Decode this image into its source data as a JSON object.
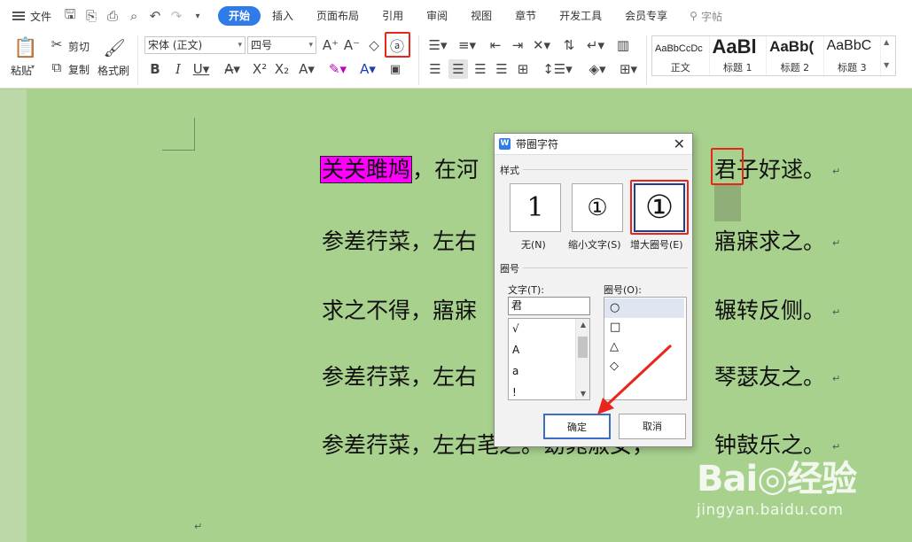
{
  "menubar": {
    "file_label": "文件",
    "tabs": [
      {
        "label": "开始",
        "active": true
      },
      {
        "label": "插入"
      },
      {
        "label": "页面布局"
      },
      {
        "label": "引用"
      },
      {
        "label": "审阅"
      },
      {
        "label": "视图"
      },
      {
        "label": "章节"
      },
      {
        "label": "开发工具"
      },
      {
        "label": "会员专享"
      }
    ],
    "search_label": "字帖"
  },
  "ribbon": {
    "paste_label": "粘贴",
    "cut_label": "剪切",
    "copy_label": "复制",
    "format_painter_label": "格式刷",
    "font_name": "宋体 (正文)",
    "font_size": "四号",
    "styles": [
      {
        "preview": "AaBbCcDc",
        "name": "正文"
      },
      {
        "preview": "AaBl",
        "name": "标题 1"
      },
      {
        "preview": "AaBb(",
        "name": "标题 2"
      },
      {
        "preview": "AaBbC",
        "name": "标题 3"
      }
    ]
  },
  "document": {
    "lines": [
      {
        "highlight": "关关雎鸠",
        "before": "，在河",
        "after": "君子好逑。"
      },
      {
        "before": "参差荇菜，左右",
        "after": "寤寐求之。"
      },
      {
        "before": "求之不得，寤寐",
        "after": "辗转反侧。"
      },
      {
        "before": "参差荇菜，左右",
        "after": "琴瑟友之。"
      },
      {
        "before": "参差荇菜，左右芼之。窈窕淑女，",
        "after": "钟鼓乐之。"
      }
    ],
    "paragraph_mark": "↵"
  },
  "dialog": {
    "title": "带圈字符",
    "close": "✕",
    "style_section": "样式",
    "style_options": [
      {
        "label": "无(N)",
        "glyph": "1"
      },
      {
        "label": "缩小文字(S)",
        "glyph": "①"
      },
      {
        "label": "增大圈号(E)",
        "glyph": "①",
        "selected": true
      }
    ],
    "enclosure_section": "圈号",
    "text_label": "文字(T):",
    "text_value": "君",
    "text_list": [
      "√",
      "A",
      "a",
      "!"
    ],
    "enclosure_label": "圈号(O):",
    "enclosure_list": [
      "○",
      "□",
      "△",
      "◇"
    ],
    "ok_label": "确定",
    "cancel_label": "取消"
  },
  "watermark": {
    "logo": "Bai◎经验",
    "url": "jingyan.baidu.com"
  },
  "colors": {
    "document_bg": "#a9d18e",
    "accent": "#2f7bea",
    "highlight": "#ff00ff",
    "annotation_red": "#e8261b"
  }
}
